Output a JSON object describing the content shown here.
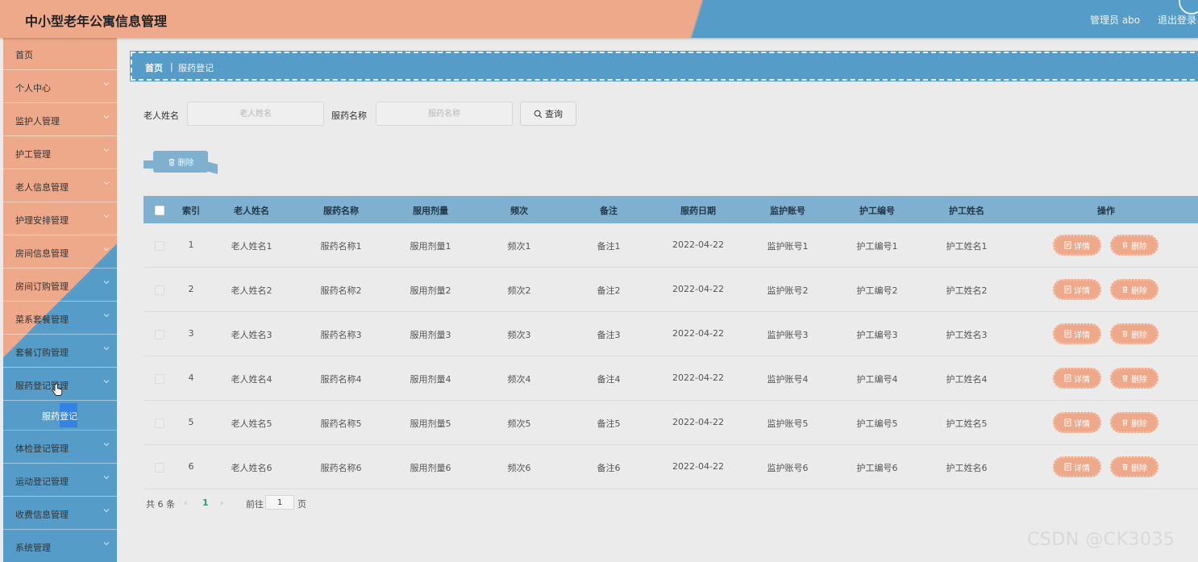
{
  "header": {
    "title": "中小型老年公寓信息管理",
    "user": "管理员 abo",
    "logout": "退出登录"
  },
  "sidebar": {
    "home": "首页",
    "items": [
      {
        "label": "个人中心"
      },
      {
        "label": "监护人管理"
      },
      {
        "label": "护工管理"
      },
      {
        "label": "老人信息管理"
      },
      {
        "label": "护理安排管理"
      },
      {
        "label": "房间信息管理"
      },
      {
        "label": "房间订购管理"
      },
      {
        "label": "菜系套餐管理"
      },
      {
        "label": "套餐订购管理"
      },
      {
        "label": "服药登记管理"
      }
    ],
    "active_sub": "服药登记",
    "items_after": [
      {
        "label": "体检登记管理"
      },
      {
        "label": "运动登记管理"
      },
      {
        "label": "收费信息管理"
      },
      {
        "label": "系统管理"
      }
    ]
  },
  "breadcrumb": {
    "home": "首页",
    "sep": "|",
    "current": "服药登记"
  },
  "search": {
    "name_label": "老人姓名",
    "name_placeholder": "老人姓名",
    "med_label": "服药名称",
    "med_placeholder": "服药名称",
    "button": "查询"
  },
  "batch_delete": "删除",
  "table": {
    "headers": [
      "索引",
      "老人姓名",
      "服药名称",
      "服用剂量",
      "频次",
      "备注",
      "服药日期",
      "监护账号",
      "护工编号",
      "护工姓名",
      "操作"
    ],
    "rows": [
      [
        "1",
        "老人姓名1",
        "服药名称1",
        "服用剂量1",
        "频次1",
        "备注1",
        "2022-04-22",
        "监护账号1",
        "护工编号1",
        "护工姓名1"
      ],
      [
        "2",
        "老人姓名2",
        "服药名称2",
        "服用剂量2",
        "频次2",
        "备注2",
        "2022-04-22",
        "监护账号2",
        "护工编号2",
        "护工姓名2"
      ],
      [
        "3",
        "老人姓名3",
        "服药名称3",
        "服用剂量3",
        "频次3",
        "备注3",
        "2022-04-22",
        "监护账号3",
        "护工编号3",
        "护工姓名3"
      ],
      [
        "4",
        "老人姓名4",
        "服药名称4",
        "服用剂量4",
        "频次4",
        "备注4",
        "2022-04-22",
        "监护账号4",
        "护工编号4",
        "护工姓名4"
      ],
      [
        "5",
        "老人姓名5",
        "服药名称5",
        "服用剂量5",
        "频次5",
        "备注5",
        "2022-04-22",
        "监护账号5",
        "护工编号5",
        "护工姓名5"
      ],
      [
        "6",
        "老人姓名6",
        "服药名称6",
        "服用剂量6",
        "频次6",
        "备注6",
        "2022-04-22",
        "监护账号6",
        "护工编号6",
        "护工姓名6"
      ]
    ],
    "detail_label": "详情",
    "delete_label": "删除"
  },
  "pager": {
    "total": "共 6 条",
    "prev": "‹",
    "current": "1",
    "next": "›",
    "goto": "前往",
    "page_value": "1",
    "page_suffix": "页"
  },
  "watermark": "CSDN @CK3035",
  "colors": {
    "peach": "#eea88a",
    "blue": "#559cc8",
    "table_head": "#7fb0cf"
  },
  "icons": [
    "chevron-down-icon",
    "search-icon",
    "trash-icon",
    "document-icon",
    "hand-cursor-icon"
  ]
}
